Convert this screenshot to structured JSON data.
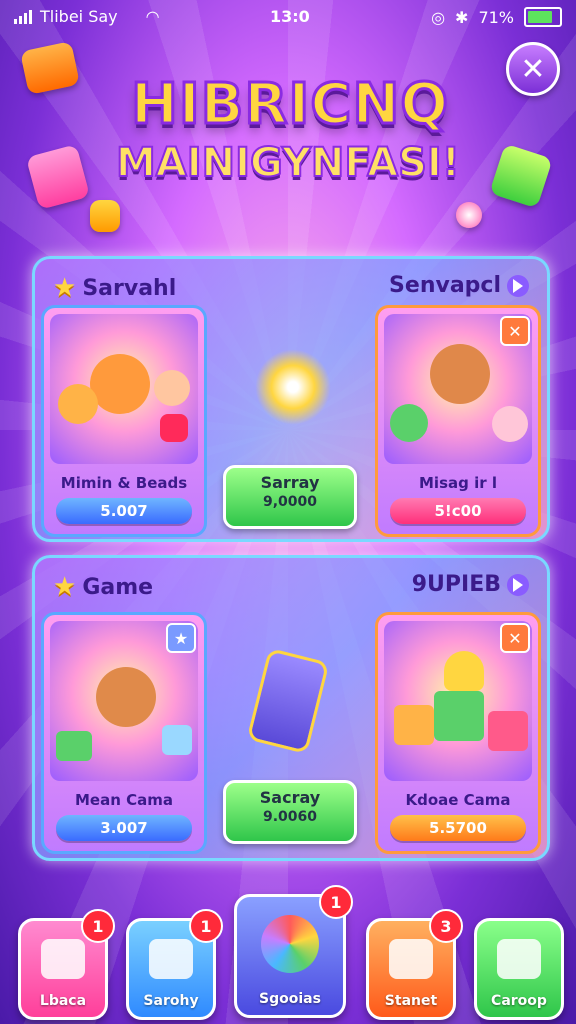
{
  "status": {
    "carrier": "Tlibei Say",
    "time": "13:0",
    "battery": "71%"
  },
  "header": {
    "title_line1": "HIBRICNQ",
    "title_line2": "MAINIGYNFASI!"
  },
  "panel1": {
    "left_title": "Sarvahl",
    "right_title": "Senvapcl",
    "cards": [
      {
        "name": "Mimin & Beads",
        "price": "5.007"
      },
      {
        "name": "Misag ir l",
        "price": "5!c00"
      }
    ],
    "center": {
      "label": "Sarray",
      "value": "9,0000"
    }
  },
  "panel2": {
    "left_title": "Game",
    "right_title": "9UPIEB",
    "cards": [
      {
        "name": "Mean Cama",
        "price": "3.007"
      },
      {
        "name": "Kdoae Cama",
        "price": "5.5700"
      }
    ],
    "center": {
      "label": "Sacray",
      "value": "9.0060"
    }
  },
  "nav": [
    {
      "label": "Lbaca",
      "badge": "1",
      "color": "#ff5ab0"
    },
    {
      "label": "Sarohy",
      "badge": "1",
      "color": "#4ab8ff"
    },
    {
      "label": "Sgooias",
      "badge": "1",
      "color": "#5a7bff"
    },
    {
      "label": "Stanet",
      "badge": "3",
      "color": "#ff7a2a"
    },
    {
      "label": "Caroop",
      "badge": "",
      "color": "#45d06a"
    }
  ]
}
